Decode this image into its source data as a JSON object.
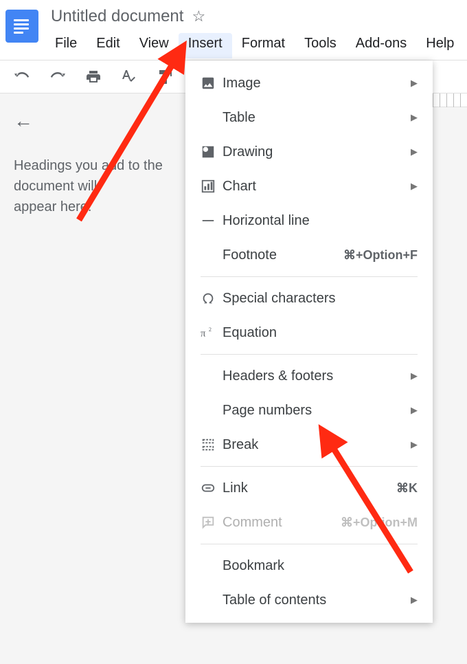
{
  "header": {
    "title": "Untitled document"
  },
  "menubar": {
    "file": "File",
    "edit": "Edit",
    "view": "View",
    "insert": "Insert",
    "format": "Format",
    "tools": "Tools",
    "addons": "Add-ons",
    "help": "Help"
  },
  "outline": {
    "hint_line1": "Headings you add to the document will",
    "hint_line2": "appear here."
  },
  "insert_menu": {
    "image": "Image",
    "table": "Table",
    "drawing": "Drawing",
    "chart": "Chart",
    "horizontal_line": "Horizontal line",
    "footnote": "Footnote",
    "footnote_shortcut": "⌘+Option+F",
    "special_characters": "Special characters",
    "equation": "Equation",
    "headers_footers": "Headers & footers",
    "page_numbers": "Page numbers",
    "break": "Break",
    "link": "Link",
    "link_shortcut": "⌘K",
    "comment": "Comment",
    "comment_shortcut": "⌘+Option+M",
    "bookmark": "Bookmark",
    "table_of_contents": "Table of contents"
  }
}
